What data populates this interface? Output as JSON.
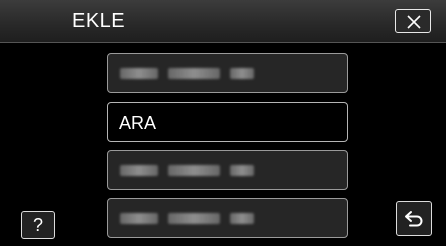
{
  "header": {
    "title": "EKLE"
  },
  "list": {
    "items": [
      {
        "label": "",
        "obscured": true
      },
      {
        "label": "ARA",
        "obscured": false
      },
      {
        "label": "",
        "obscured": true
      },
      {
        "label": "",
        "obscured": true
      }
    ]
  },
  "buttons": {
    "close_icon": "close-icon",
    "help_label": "?",
    "back_icon": "return-icon"
  },
  "colors": {
    "background": "#000000",
    "header": "#2e2e2e",
    "button_fill": "#262626",
    "button_border": "#9a9a9a",
    "text": "#ffffff"
  }
}
